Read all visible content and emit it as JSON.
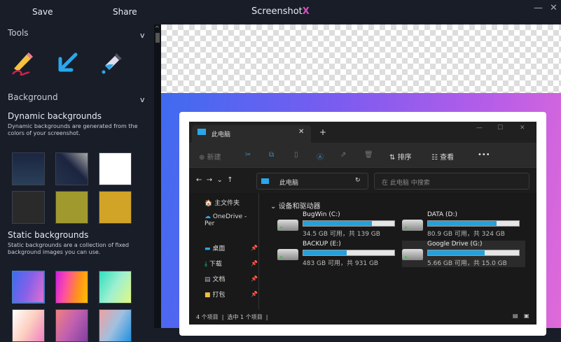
{
  "topbar": {
    "save": "Save",
    "share": "Share",
    "title": "Screenshot",
    "title_mark": "X",
    "minimize": "—",
    "close": "✕"
  },
  "sidebar": {
    "tools_label": "Tools",
    "background_label": "Background",
    "dynamic_title": "Dynamic backgrounds",
    "dynamic_desc": "Dynamic backgrounds are generated from the colors of your screenshot.",
    "static_title": "Static backgrounds",
    "static_desc": "Static backgrounds are a collection of fixed background images you can use.",
    "dynamic_colors": [
      "#1f2b45",
      "#2a3550",
      "#ffffff",
      "#2a2a2a",
      "#a09a2e",
      "#d1a327"
    ]
  },
  "explorer": {
    "tab_title": "此电脑",
    "toolbar": {
      "new": "新建",
      "sort": "排序",
      "view": "查看",
      "more": "•••"
    },
    "address": "此电脑",
    "search_placeholder": "在 此电脑 中搜索",
    "nav": [
      {
        "label": "主文件夹",
        "icon": "home-icon"
      },
      {
        "label": "OneDrive - Per",
        "icon": "cloud-icon"
      },
      {
        "label": "桌面",
        "icon": "desktop-icon",
        "pinned": true
      },
      {
        "label": "下载",
        "icon": "download-icon",
        "pinned": true
      },
      {
        "label": "文档",
        "icon": "document-icon",
        "pinned": true
      },
      {
        "label": "打包",
        "icon": "folder-icon",
        "pinned": true
      }
    ],
    "section": "设备和驱动器",
    "drives": [
      {
        "name": "BugWin (C:)",
        "size": "34.5 GB 可用，共 139 GB",
        "used_percent": 75
      },
      {
        "name": "DATA (D:)",
        "size": "80.9 GB 可用，共 324 GB",
        "used_percent": 75
      },
      {
        "name": "BACKUP (E:)",
        "size": "483 GB 可用，共 931 GB",
        "used_percent": 48
      },
      {
        "name": "Google Drive (G:)",
        "size": "5.66 GB 可用，共 15.0 GB",
        "used_percent": 62
      }
    ],
    "status_items": "4 个项目",
    "status_selected": "选中 1 个项目"
  }
}
